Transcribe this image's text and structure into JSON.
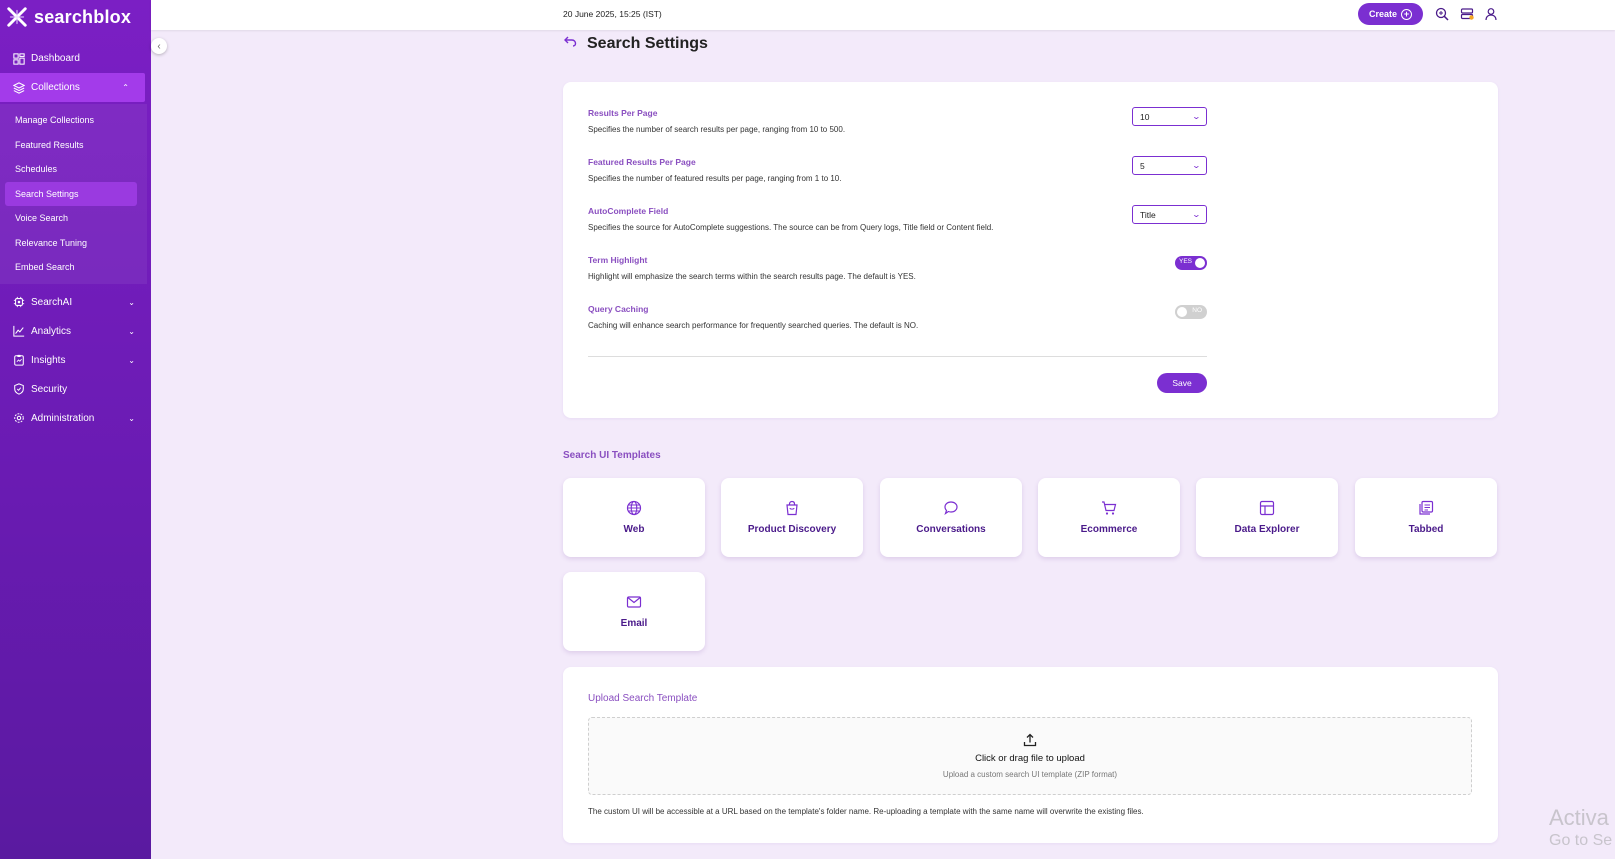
{
  "brand": {
    "name": "searchblox",
    "accent": "#7b2fd1",
    "sidebar_color": "#7b1fc4"
  },
  "header": {
    "datetime": "20 June 2025, 15:25 (IST)",
    "create_label": "Create"
  },
  "sidebar": {
    "items": [
      {
        "label": "Dashboard",
        "icon": "dashboard-icon"
      },
      {
        "label": "Collections",
        "icon": "layers-icon",
        "expanded": true
      },
      {
        "label": "SearchAI",
        "icon": "ai-chip-icon"
      },
      {
        "label": "Analytics",
        "icon": "chart-icon"
      },
      {
        "label": "Insights",
        "icon": "clipboard-icon"
      },
      {
        "label": "Security",
        "icon": "shield-icon"
      },
      {
        "label": "Administration",
        "icon": "gear-icon"
      }
    ],
    "collections_sub": [
      "Manage Collections",
      "Featured Results",
      "Schedules",
      "Search Settings",
      "Voice Search",
      "Relevance Tuning",
      "Embed Search"
    ]
  },
  "page": {
    "title": "Search Settings"
  },
  "settings": {
    "results_per_page": {
      "label": "Results Per Page",
      "desc": "Specifies the number of search results per page, ranging from 10 to 500.",
      "value": "10"
    },
    "featured_per_page": {
      "label": "Featured Results Per Page",
      "desc": "Specifies the number of featured results per page, ranging from 1 to 10.",
      "value": "5"
    },
    "autocomplete": {
      "label": "AutoComplete Field",
      "desc": "Specifies the source for AutoComplete suggestions. The source can be from Query logs, Title field or Content field.",
      "value": "Title"
    },
    "term_highlight": {
      "label": "Term Highlight",
      "desc": "Highlight will emphasize the search terms within the search results page. The default is YES.",
      "state": "YES"
    },
    "query_caching": {
      "label": "Query Caching",
      "desc": "Caching will enhance search performance for frequently searched queries. The default is NO.",
      "state": "NO"
    },
    "save_label": "Save"
  },
  "templates": {
    "title": "Search UI Templates",
    "items": [
      {
        "name": "Web",
        "icon": "globe-icon"
      },
      {
        "name": "Product Discovery",
        "icon": "shopping-bag-icon"
      },
      {
        "name": "Conversations",
        "icon": "chat-bubble-icon"
      },
      {
        "name": "Ecommerce",
        "icon": "cart-icon"
      },
      {
        "name": "Data Explorer",
        "icon": "table-icon"
      },
      {
        "name": "Tabbed",
        "icon": "tabs-icon"
      },
      {
        "name": "Email",
        "icon": "mail-icon"
      }
    ]
  },
  "upload": {
    "title": "Upload Search Template",
    "main": "Click or drag file to upload",
    "sub": "Upload a custom search UI template (ZIP format)",
    "note": "The custom UI will be accessible at a URL based on the template's folder name. Re-uploading a template with the same name will overwrite the existing files."
  },
  "watermark": {
    "line1": "Activa",
    "line2": "Go to Se"
  }
}
